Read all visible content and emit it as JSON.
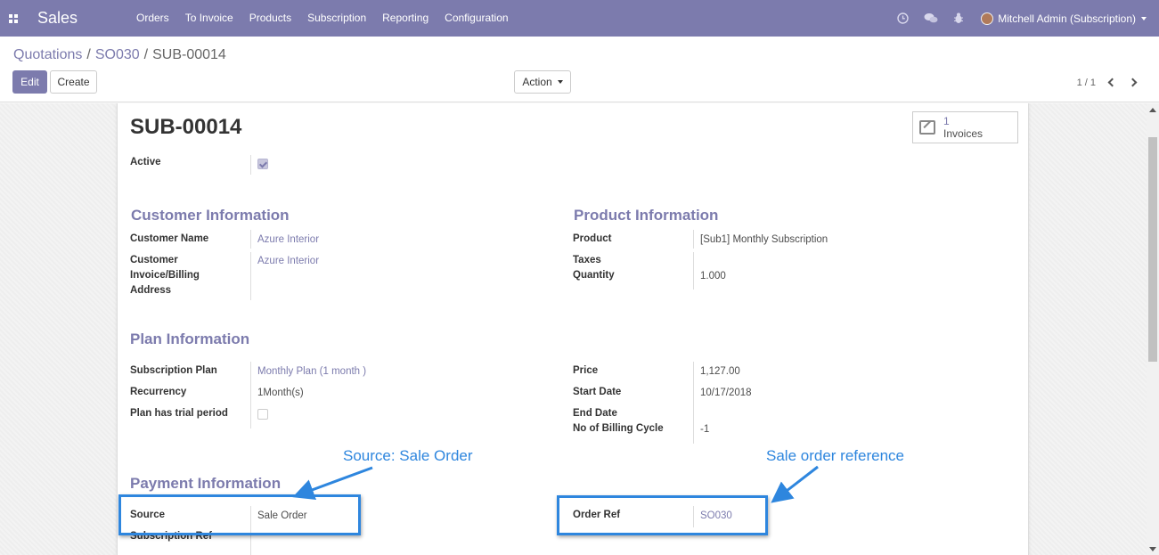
{
  "navbar": {
    "app_name": "Sales",
    "menu": [
      "Orders",
      "To Invoice",
      "Products",
      "Subscription",
      "Reporting",
      "Configuration"
    ],
    "user_name": "Mitchell Admin (Subscription)",
    "icons": [
      "clock-icon",
      "chat-icon",
      "bug-icon"
    ],
    "color": "#7c7bad"
  },
  "control": {
    "breadcrumb": [
      "Quotations",
      "SO030",
      "SUB-00014"
    ],
    "edit_label": "Edit",
    "create_label": "Create",
    "action_label": "Action",
    "pager": "1 / 1"
  },
  "record": {
    "title": "SUB-00014",
    "stat_button": {
      "count": "1",
      "label": "Invoices"
    },
    "active_label": "Active",
    "active": true
  },
  "customer": {
    "section_title": "Customer Information",
    "name_label": "Customer Name",
    "name_value": "Azure Interior",
    "invoice_label_lines": [
      "Customer",
      "Invoice/Billing",
      "Address"
    ],
    "invoice_value": "Azure Interior"
  },
  "product": {
    "section_title": "Product Information",
    "product_label": "Product",
    "product_value": "[Sub1] Monthly Subscription",
    "taxes_label": "Taxes",
    "quantity_label": "Quantity",
    "quantity_value": "1.000"
  },
  "plan": {
    "section_title": "Plan Information",
    "plan_label": "Subscription Plan",
    "plan_value": "Monthly Plan (1 month )",
    "recurrency_label": "Recurrency",
    "recurrency_value": "1Month(s)",
    "trial_label": "Plan has trial period",
    "trial": false,
    "price_label": "Price",
    "price_value": "1,127.00",
    "start_label": "Start Date",
    "start_value": "10/17/2018",
    "end_label": "End Date",
    "cycle_label": "No of Billing Cycle",
    "cycle_value": "-1"
  },
  "payment": {
    "section_title": "Payment Information",
    "source_label": "Source",
    "source_value": "Sale Order",
    "subref_label": "Subscription Ref",
    "orderref_label": "Order Ref",
    "orderref_value": "SO030"
  },
  "annotations": {
    "source_note": "Source: Sale Order",
    "orderref_note": "Sale order reference",
    "color": "#2e86de"
  }
}
